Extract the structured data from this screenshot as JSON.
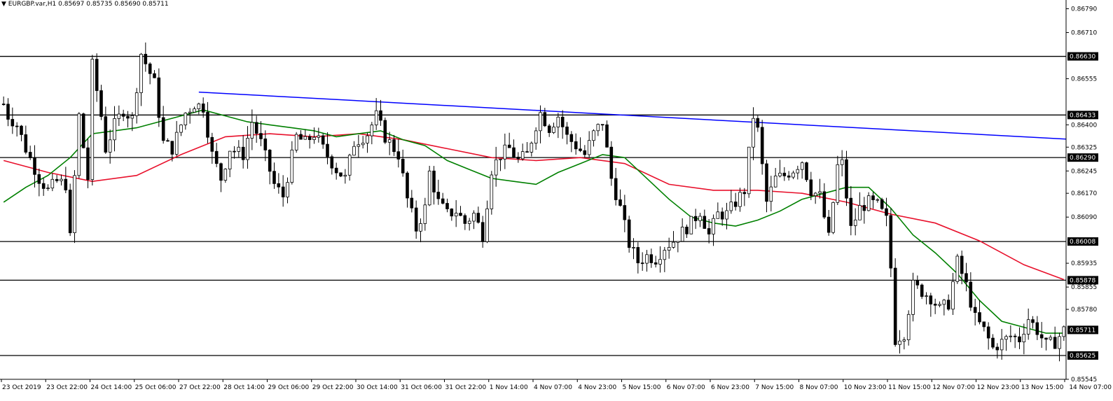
{
  "header": {
    "symbol_label": "EURGBP.var,H1",
    "open": "0.85697",
    "high": "0.85735",
    "low": "0.85690",
    "close": "0.85711"
  },
  "colors": {
    "background": "#ffffff",
    "axis": "#000000",
    "bull_body": "#ffffff",
    "bear_body": "#000000",
    "wick": "#000000",
    "trend_line": "#0000ff",
    "ma_fast": "#008000",
    "ma_slow": "#e8102b",
    "level_line": "#000000",
    "price_tag_bg": "#000000",
    "price_tag_text": "#ffffff"
  },
  "chart_data": {
    "type": "candlestick",
    "symbol": "EURGBP.var",
    "timeframe": "H1",
    "ylim": [
      0.85545,
      0.8681
    ],
    "y_ticks": [
      "0.86790",
      "0.86710",
      "0.86555",
      "0.86400",
      "0.86325",
      "0.86245",
      "0.86170",
      "0.86090",
      "0.85935",
      "0.85855",
      "0.85780",
      "0.85545"
    ],
    "x_ticks": [
      "23 Oct 2019",
      "23 Oct 22:00",
      "24 Oct 14:00",
      "25 Oct 06:00",
      "27 Oct 22:00",
      "28 Oct 14:00",
      "29 Oct 06:00",
      "29 Oct 22:00",
      "30 Oct 14:00",
      "31 Oct 06:00",
      "31 Oct 22:00",
      "1 Nov 14:00",
      "4 Nov 07:00",
      "4 Nov 23:00",
      "5 Nov 15:00",
      "6 Nov 07:00",
      "6 Nov 23:00",
      "7 Nov 15:00",
      "8 Nov 07:00",
      "10 Nov 23:00",
      "11 Nov 15:00",
      "12 Nov 07:00",
      "12 Nov 23:00",
      "13 Nov 15:00",
      "14 Nov 07:00"
    ],
    "candle_count": 240,
    "horizontal_levels": [
      {
        "price": 0.8663,
        "label": "0.86630"
      },
      {
        "price": 0.86433,
        "label": "0.86433"
      },
      {
        "price": 0.8629,
        "label": "0.86290"
      },
      {
        "price": 0.86008,
        "label": "0.86008"
      },
      {
        "price": 0.85878,
        "label": "0.85878"
      },
      {
        "price": 0.85625,
        "label": "0.85625"
      }
    ],
    "current_price": {
      "price": 0.85711,
      "label": "0.85711"
    },
    "trend_line": {
      "start": [
        44,
        0.8651
      ],
      "end": [
        240,
        0.86352
      ]
    },
    "anchors": [
      [
        0,
        0.8647
      ],
      [
        1,
        0.8643
      ],
      [
        3,
        0.864
      ],
      [
        5,
        0.8632
      ],
      [
        8,
        0.8622
      ],
      [
        10,
        0.8618
      ],
      [
        12,
        0.8621
      ],
      [
        14,
        0.862
      ],
      [
        15,
        0.8602
      ],
      [
        17,
        0.8643
      ],
      [
        19,
        0.8622
      ],
      [
        20,
        0.866
      ],
      [
        22,
        0.8643
      ],
      [
        23,
        0.8632
      ],
      [
        25,
        0.864
      ],
      [
        27,
        0.8645
      ],
      [
        29,
        0.8642
      ],
      [
        31,
        0.8664
      ],
      [
        34,
        0.8654
      ],
      [
        36,
        0.8634
      ],
      [
        38,
        0.8632
      ],
      [
        41,
        0.8644
      ],
      [
        43,
        0.8647
      ],
      [
        45,
        0.8646
      ],
      [
        47,
        0.863
      ],
      [
        49,
        0.8622
      ],
      [
        51,
        0.8632
      ],
      [
        54,
        0.863
      ],
      [
        56,
        0.8641
      ],
      [
        58,
        0.8634
      ],
      [
        61,
        0.862
      ],
      [
        63,
        0.8616
      ],
      [
        66,
        0.8636
      ],
      [
        68,
        0.8634
      ],
      [
        70,
        0.8637
      ],
      [
        72,
        0.8632
      ],
      [
        75,
        0.8625
      ],
      [
        77,
        0.8622
      ],
      [
        79,
        0.8634
      ],
      [
        82,
        0.8637
      ],
      [
        84,
        0.8643
      ],
      [
        86,
        0.8636
      ],
      [
        89,
        0.863
      ],
      [
        91,
        0.8615
      ],
      [
        93,
        0.8605
      ],
      [
        95,
        0.8612
      ],
      [
        96,
        0.8624
      ],
      [
        98,
        0.8614
      ],
      [
        100,
        0.861
      ],
      [
        102,
        0.8611
      ],
      [
        104,
        0.8607
      ],
      [
        106,
        0.861
      ],
      [
        108,
        0.8603
      ],
      [
        110,
        0.8625
      ],
      [
        112,
        0.863
      ],
      [
        114,
        0.8632
      ],
      [
        116,
        0.8628
      ],
      [
        118,
        0.863
      ],
      [
        120,
        0.864
      ],
      [
        121,
        0.8644
      ],
      [
        123,
        0.8639
      ],
      [
        125,
        0.8643
      ],
      [
        127,
        0.8636
      ],
      [
        129,
        0.8633
      ],
      [
        131,
        0.863
      ],
      [
        133,
        0.8637
      ],
      [
        135,
        0.8641
      ],
      [
        137,
        0.8622
      ],
      [
        139,
        0.8612
      ],
      [
        141,
        0.86
      ],
      [
        143,
        0.8594
      ],
      [
        145,
        0.8596
      ],
      [
        147,
        0.8595
      ],
      [
        149,
        0.8599
      ],
      [
        151,
        0.8601
      ],
      [
        153,
        0.8604
      ],
      [
        155,
        0.8607
      ],
      [
        157,
        0.8611
      ],
      [
        159,
        0.8603
      ],
      [
        161,
        0.861
      ],
      [
        163,
        0.861
      ],
      [
        165,
        0.8614
      ],
      [
        167,
        0.8618
      ],
      [
        169,
        0.8643
      ],
      [
        170,
        0.8638
      ],
      [
        172,
        0.8614
      ],
      [
        174,
        0.8622
      ],
      [
        176,
        0.8623
      ],
      [
        178,
        0.8625
      ],
      [
        180,
        0.8628
      ],
      [
        182,
        0.8618
      ],
      [
        184,
        0.8616
      ],
      [
        186,
        0.8602
      ],
      [
        188,
        0.8626
      ],
      [
        189,
        0.8627
      ],
      [
        191,
        0.8605
      ],
      [
        193,
        0.8612
      ],
      [
        195,
        0.8614
      ],
      [
        197,
        0.8613
      ],
      [
        199,
        0.8608
      ],
      [
        200,
        0.8592
      ],
      [
        201,
        0.8568
      ],
      [
        203,
        0.857
      ],
      [
        205,
        0.8586
      ],
      [
        207,
        0.8584
      ],
      [
        209,
        0.8582
      ],
      [
        211,
        0.8578
      ],
      [
        213,
        0.858
      ],
      [
        215,
        0.8594
      ],
      [
        217,
        0.8586
      ],
      [
        219,
        0.8575
      ],
      [
        221,
        0.8571
      ],
      [
        223,
        0.8565
      ],
      [
        225,
        0.8567
      ],
      [
        227,
        0.8569
      ],
      [
        229,
        0.8568
      ],
      [
        231,
        0.8575
      ],
      [
        233,
        0.8571
      ],
      [
        235,
        0.8566
      ],
      [
        237,
        0.8567
      ],
      [
        239,
        0.8571
      ]
    ],
    "ma_fast": [
      [
        0,
        0.8614
      ],
      [
        5,
        0.8619
      ],
      [
        10,
        0.8623
      ],
      [
        15,
        0.8629
      ],
      [
        20,
        0.8637
      ],
      [
        25,
        0.8638
      ],
      [
        30,
        0.8639
      ],
      [
        35,
        0.8641
      ],
      [
        40,
        0.8643
      ],
      [
        45,
        0.8645
      ],
      [
        50,
        0.8643
      ],
      [
        55,
        0.8641
      ],
      [
        60,
        0.864
      ],
      [
        65,
        0.8639
      ],
      [
        70,
        0.8638
      ],
      [
        75,
        0.8636
      ],
      [
        80,
        0.8637
      ],
      [
        85,
        0.8638
      ],
      [
        90,
        0.8635
      ],
      [
        95,
        0.8633
      ],
      [
        100,
        0.8628
      ],
      [
        105,
        0.8625
      ],
      [
        110,
        0.8622
      ],
      [
        115,
        0.8621
      ],
      [
        120,
        0.862
      ],
      [
        125,
        0.8624
      ],
      [
        130,
        0.8627
      ],
      [
        135,
        0.863
      ],
      [
        140,
        0.8629
      ],
      [
        145,
        0.8622
      ],
      [
        150,
        0.8615
      ],
      [
        155,
        0.8609
      ],
      [
        160,
        0.8607
      ],
      [
        165,
        0.8606
      ],
      [
        170,
        0.8608
      ],
      [
        175,
        0.8611
      ],
      [
        180,
        0.8615
      ],
      [
        185,
        0.8617
      ],
      [
        190,
        0.8619
      ],
      [
        195,
        0.8619
      ],
      [
        200,
        0.8612
      ],
      [
        205,
        0.8603
      ],
      [
        210,
        0.8597
      ],
      [
        215,
        0.859
      ],
      [
        220,
        0.8581
      ],
      [
        225,
        0.8574
      ],
      [
        230,
        0.8572
      ],
      [
        235,
        0.857
      ],
      [
        240,
        0.857
      ]
    ],
    "ma_slow": [
      [
        0,
        0.8628
      ],
      [
        10,
        0.8624
      ],
      [
        20,
        0.8621
      ],
      [
        30,
        0.8623
      ],
      [
        40,
        0.863
      ],
      [
        50,
        0.8636
      ],
      [
        60,
        0.8637
      ],
      [
        70,
        0.8636
      ],
      [
        80,
        0.8637
      ],
      [
        90,
        0.8635
      ],
      [
        100,
        0.8632
      ],
      [
        110,
        0.8629
      ],
      [
        120,
        0.8628
      ],
      [
        130,
        0.8629
      ],
      [
        140,
        0.8627
      ],
      [
        150,
        0.862
      ],
      [
        160,
        0.8618
      ],
      [
        170,
        0.8618
      ],
      [
        180,
        0.8617
      ],
      [
        190,
        0.8614
      ],
      [
        200,
        0.861
      ],
      [
        210,
        0.8607
      ],
      [
        220,
        0.8601
      ],
      [
        230,
        0.8593
      ],
      [
        240,
        0.8588
      ]
    ]
  }
}
